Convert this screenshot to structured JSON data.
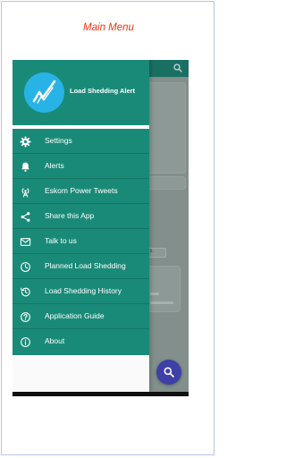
{
  "caption": "Main Menu",
  "drawer": {
    "app_name": "Load Shedding Alert",
    "items": [
      {
        "label": "Settings",
        "icon": "gear-icon"
      },
      {
        "label": "Alerts",
        "icon": "bell-icon"
      },
      {
        "label": "Eskom Power Tweets",
        "icon": "broadcast-icon"
      },
      {
        "label": "Share this App",
        "icon": "share-icon"
      },
      {
        "label": "Talk to us",
        "icon": "mail-icon"
      },
      {
        "label": "Planned Load Shedding",
        "icon": "schedule-icon"
      },
      {
        "label": "Load Shedding History",
        "icon": "history-icon"
      },
      {
        "label": "Application Guide",
        "icon": "help-icon"
      },
      {
        "label": "About",
        "icon": "info-icon"
      }
    ]
  },
  "background": {
    "chip_label": "utes."
  },
  "colors": {
    "primary": "#1a8a78",
    "accent": "#3f3fa8",
    "caption": "#e8350f",
    "logo": "#28b3e6"
  }
}
